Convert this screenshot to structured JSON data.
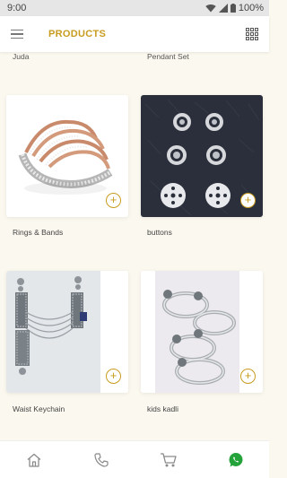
{
  "status_bar": {
    "time": "9:00",
    "battery": "100%"
  },
  "app_bar": {
    "title": "PRODUCTS"
  },
  "top_labels": [
    "Juda",
    "Pendant Set"
  ],
  "products": [
    {
      "name": "Rings & Bands"
    },
    {
      "name": "buttons"
    },
    {
      "name": "Waist Keychain"
    },
    {
      "name": "kids kadli"
    }
  ],
  "add_symbol": "+",
  "colors": {
    "accent": "#c89c1f",
    "whatsapp": "#25a33b",
    "background": "#fbf8ef"
  },
  "bottom_nav": [
    "home-icon",
    "phone-icon",
    "cart-icon",
    "whatsapp-icon"
  ]
}
